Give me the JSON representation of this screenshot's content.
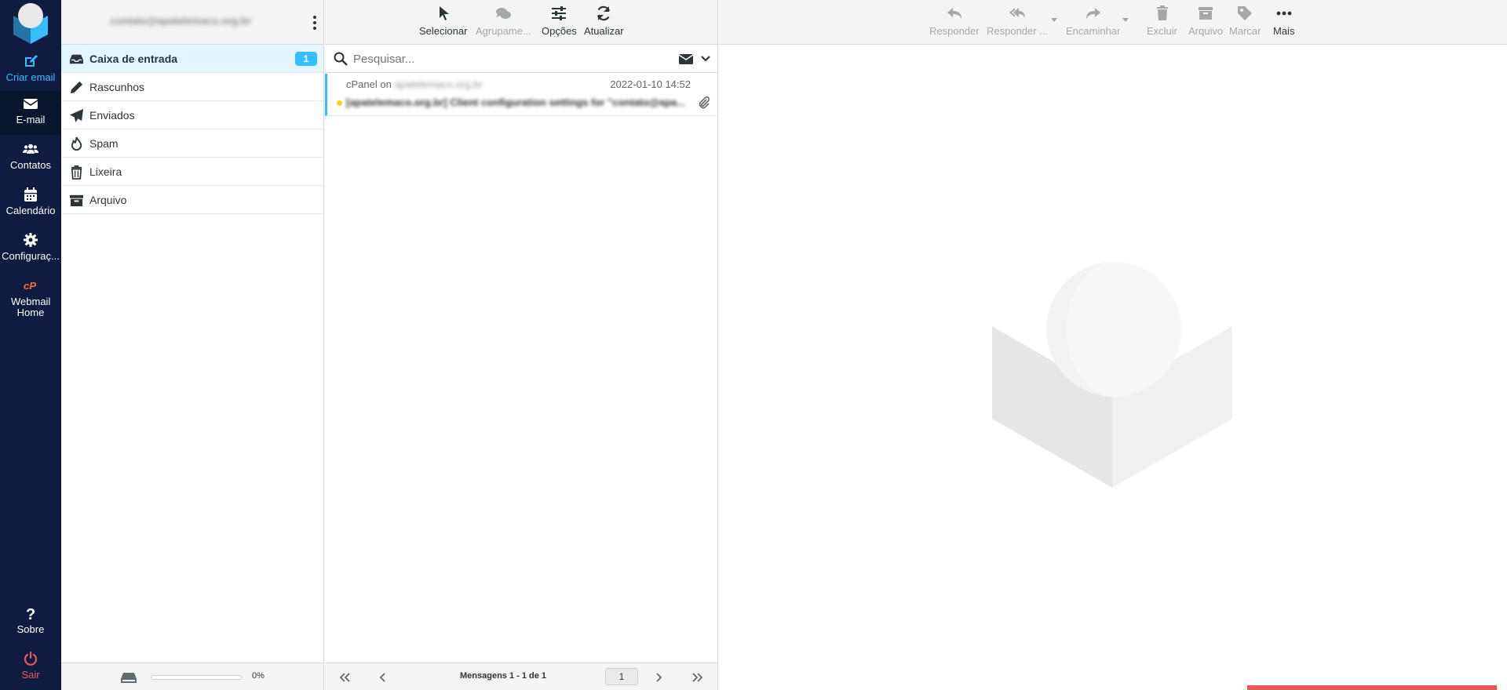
{
  "nav": {
    "items": [
      {
        "label": "Criar email",
        "icon": "compose-icon"
      },
      {
        "label": "E-mail",
        "icon": "envelope-icon"
      },
      {
        "label": "Contatos",
        "icon": "users-icon"
      },
      {
        "label": "Calendário",
        "icon": "calendar-icon"
      },
      {
        "label": "Configuraç...",
        "icon": "gear-icon"
      },
      {
        "label": "Webmail Home",
        "icon": "cpanel-icon"
      }
    ],
    "bottom": [
      {
        "label": "Sobre",
        "icon": "question-icon"
      },
      {
        "label": "Sair",
        "icon": "power-icon"
      }
    ],
    "accent": "#37beff",
    "logout_color": "#e85a5a",
    "bg": "#0f1b40"
  },
  "folders": {
    "account": "contato@apatelemaco.org.br",
    "items": [
      {
        "label": "Caixa de entrada",
        "icon": "inbox-icon",
        "badge": "1"
      },
      {
        "label": "Rascunhos",
        "icon": "pencil-icon"
      },
      {
        "label": "Enviados",
        "icon": "send-icon"
      },
      {
        "label": "Spam",
        "icon": "fire-icon"
      },
      {
        "label": "Lixeira",
        "icon": "trash-icon"
      },
      {
        "label": "Arquivo",
        "icon": "archive-icon"
      }
    ],
    "quota_percent": "0%",
    "quota_fraction": 0
  },
  "list_toolbar": {
    "select": "Selecionar",
    "threads": "Agrupame...",
    "options": "Opções",
    "refresh": "Atualizar"
  },
  "search": {
    "placeholder": "Pesquisar..."
  },
  "message": {
    "from_name": "cPanel on",
    "from_domain": "apatelemaco.org.br",
    "date": "2022-01-10 14:52",
    "subject": "[apatelemaco.org.br] Client configuration settings for \"contato@apa...",
    "unread": true,
    "has_attachment": true
  },
  "list_footer": {
    "count": "Mensagens 1 - 1 de 1",
    "page": "1"
  },
  "preview_toolbar": {
    "reply": "Responder",
    "reply_all": "Responder ...",
    "forward": "Encaminhar",
    "delete": "Excluir",
    "archive": "Arquivo",
    "mark": "Marcar",
    "more": "Mais"
  }
}
